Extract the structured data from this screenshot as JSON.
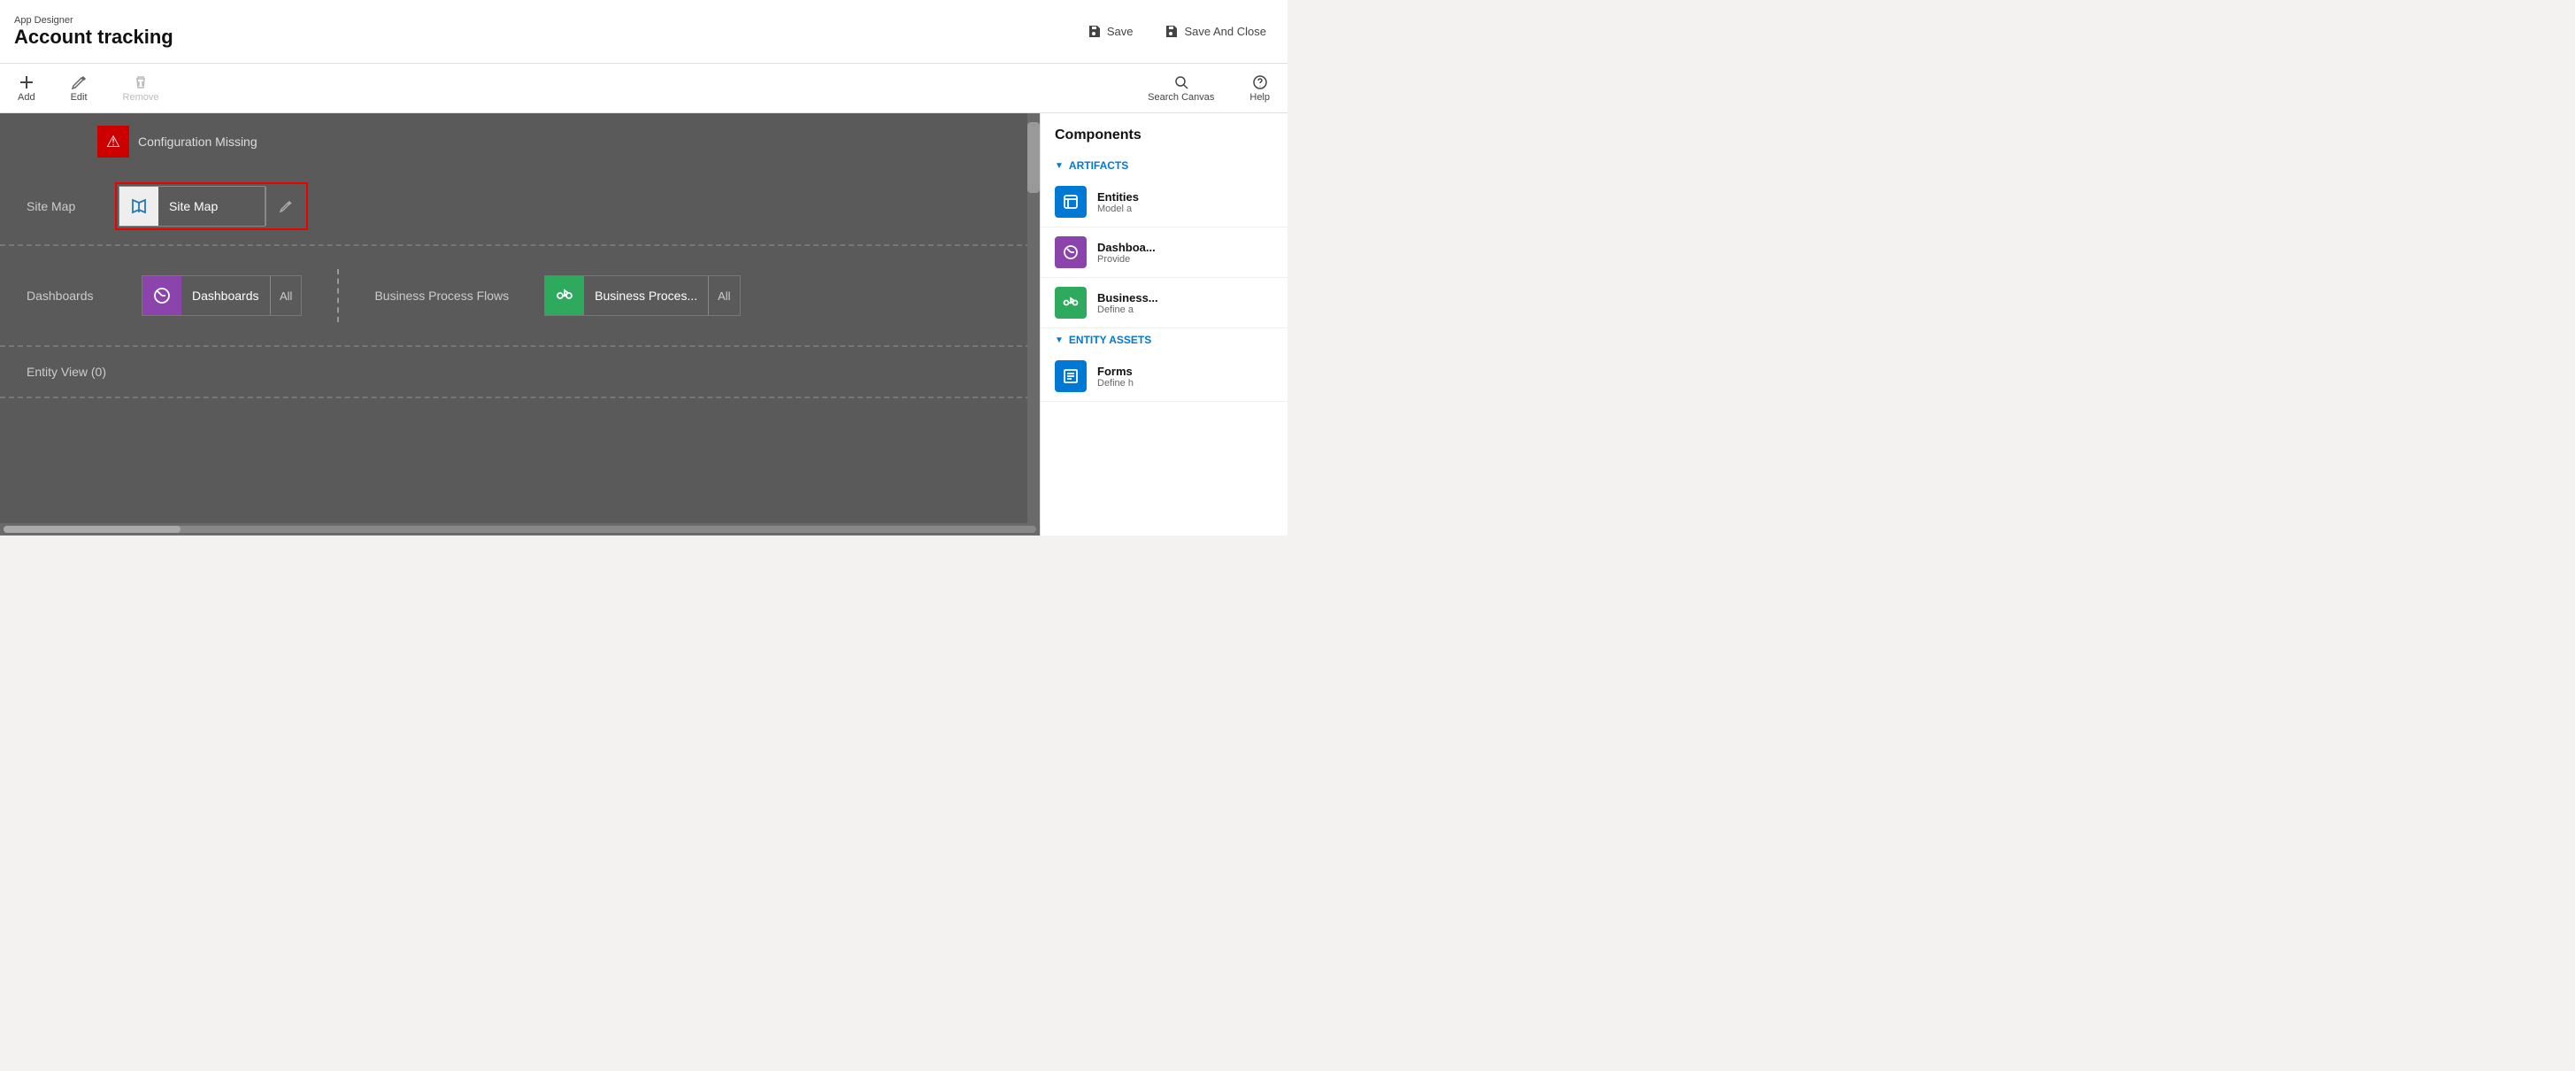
{
  "header": {
    "app_designer_label": "App Designer",
    "app_title": "Account tracking",
    "save_label": "Save",
    "save_close_label": "Save And Close"
  },
  "toolbar": {
    "add_label": "Add",
    "edit_label": "Edit",
    "remove_label": "Remove",
    "search_canvas_label": "Search Canvas",
    "help_label": "Help"
  },
  "canvas": {
    "config_missing_text": "Configuration Missing",
    "sitemap_label": "Site Map",
    "sitemap_card_text": "Site Map",
    "dashboards_label": "Dashboards",
    "dashboards_card_text": "Dashboards",
    "dashboards_all": "All",
    "bpf_label": "Business Process Flows",
    "bpf_card_text": "Business Proces...",
    "bpf_all": "All",
    "entity_view_label": "Entity View (0)"
  },
  "components": {
    "title": "Components",
    "artifacts_label": "ARTIFACTS",
    "entity_assets_label": "ENTITY ASSETS",
    "items": [
      {
        "name": "Entities",
        "desc": "Model a",
        "icon_type": "blue"
      },
      {
        "name": "Dashboa...",
        "desc": "Provide",
        "icon_type": "purple"
      },
      {
        "name": "Business...",
        "desc": "Define a",
        "icon_type": "green"
      },
      {
        "name": "Forms",
        "desc": "Define h",
        "icon_type": "blue"
      }
    ]
  }
}
